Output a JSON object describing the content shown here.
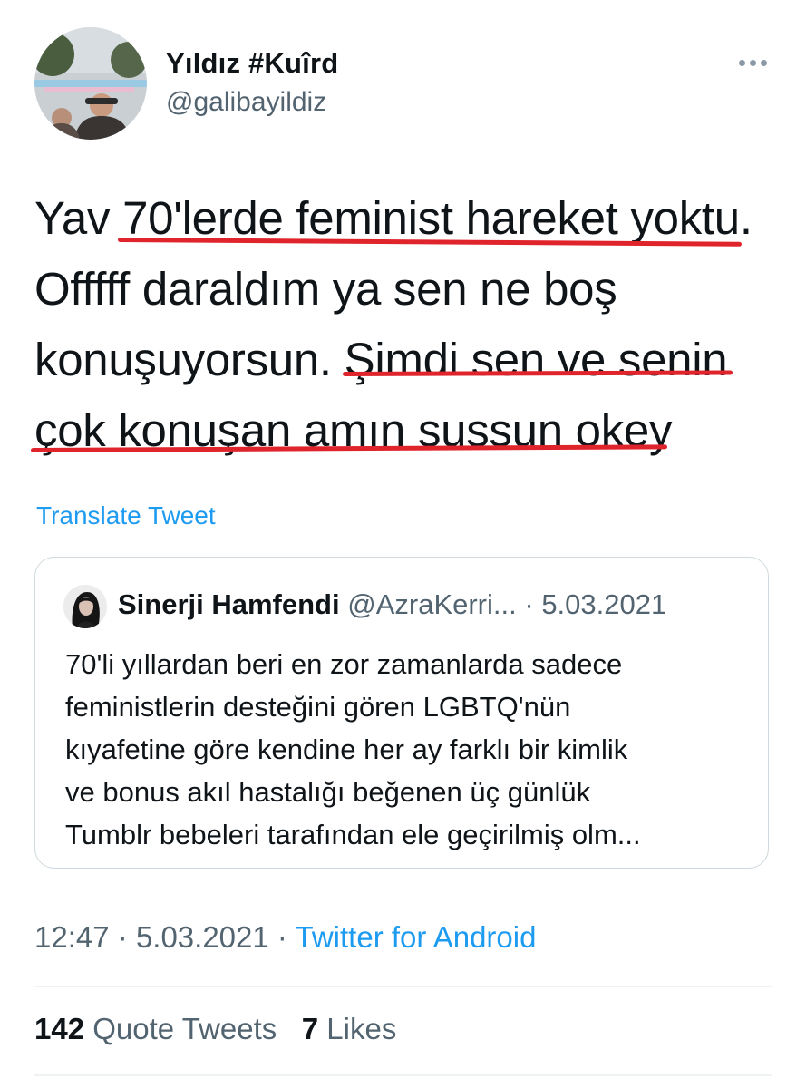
{
  "author": {
    "display_name": "Yıldız #Kuîrd",
    "handle": "@galibayildiz"
  },
  "tweet": {
    "lines": [
      "Yav 70'lerde feminist hareket yoktu.",
      "Offfff daraldım ya sen ne boş",
      "konuşuyorsun. Şimdi sen ve senin",
      "çok konuşan amın sussun okey"
    ]
  },
  "translate_label": "Translate Tweet",
  "quoted_tweet": {
    "name": "Sinerji Hamfendi",
    "handle": "@AzraKerri...",
    "date": "5.03.2021",
    "separator": "·",
    "lines": [
      "70'li yıllardan beri en zor zamanlarda sadece",
      "feministlerin desteğini gören LGBTQ'nün",
      "kıyafetine göre kendine her ay farklı bir kimlik",
      "ve bonus akıl hastalığı beğenen üç günlük",
      "Tumblr bebeleri tarafından ele geçirilmiş olm..."
    ]
  },
  "meta": {
    "time": "12:47",
    "date": "5.03.2021",
    "separator": "·",
    "source": "Twitter for Android"
  },
  "stats": {
    "quote_count": "142",
    "quote_label": "Quote Tweets",
    "like_count": "7",
    "like_label": "Likes"
  },
  "colors": {
    "link": "#1d9bf0",
    "underline": "#e0242c",
    "secondary_text": "#536471"
  },
  "icons": {
    "more": "more-horizontal-icon"
  }
}
